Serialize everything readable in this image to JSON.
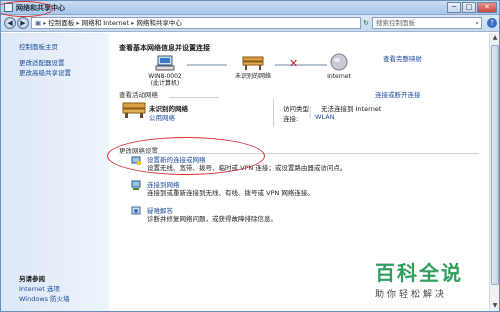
{
  "window": {
    "title": "网络和共享中心",
    "buttons": [
      "─",
      "□",
      "✕"
    ]
  },
  "address": {
    "crumbs": [
      "控制面板",
      "网络和 Internet",
      "网络和共享中心"
    ],
    "search_placeholder": "搜索控制面板"
  },
  "sidebar": {
    "links": [
      "控制面板主页",
      "更改适配器设置",
      "更改高级共享设置"
    ],
    "see_also_title": "另请参阅",
    "see_also_links": [
      "Internet 选项",
      "Windows 防火墙"
    ]
  },
  "main": {
    "title": "查看基本网络信息并设置连接",
    "full_map_link": "查看完整映射",
    "nodes": [
      {
        "label": "WIN8-0002\n(此计算机)",
        "icon": "computer-icon"
      },
      {
        "label": "未识别的网络",
        "icon": "bench-network-icon"
      },
      {
        "label": "Internet",
        "icon": "globe-icon"
      }
    ],
    "active_header": "查看活动网络",
    "connect_link": "连接或断开连接",
    "network_name": "未识别的网络",
    "network_type": "公用网络",
    "access_type_label": "访问类型:",
    "access_type_value": "无法连接到 Internet",
    "connection_label": "连接:",
    "connection_value": "WLAN",
    "change_header": "更改网络设置",
    "tasks": [
      {
        "link": "设置新的连接或网络",
        "desc": "设置无线、宽带、拨号、临时或 VPN 连接；或设置路由器或访问点。",
        "icon": "new-connection-icon"
      },
      {
        "link": "连接到网络",
        "desc": "连接到或重新连接到无线、有线、拨号或 VPN 网络连接。",
        "icon": "connect-network-icon"
      },
      {
        "link": "疑难解答",
        "desc": "诊断并修复网络问题，或获得故障排除信息。",
        "icon": "troubleshoot-icon"
      }
    ]
  },
  "watermark": {
    "line1": "百科全说",
    "line2": "助你轻松解决"
  },
  "colors": {
    "link": "#1a4a9a",
    "watermark": "#2f9e5e",
    "highlight": "#d83030"
  }
}
